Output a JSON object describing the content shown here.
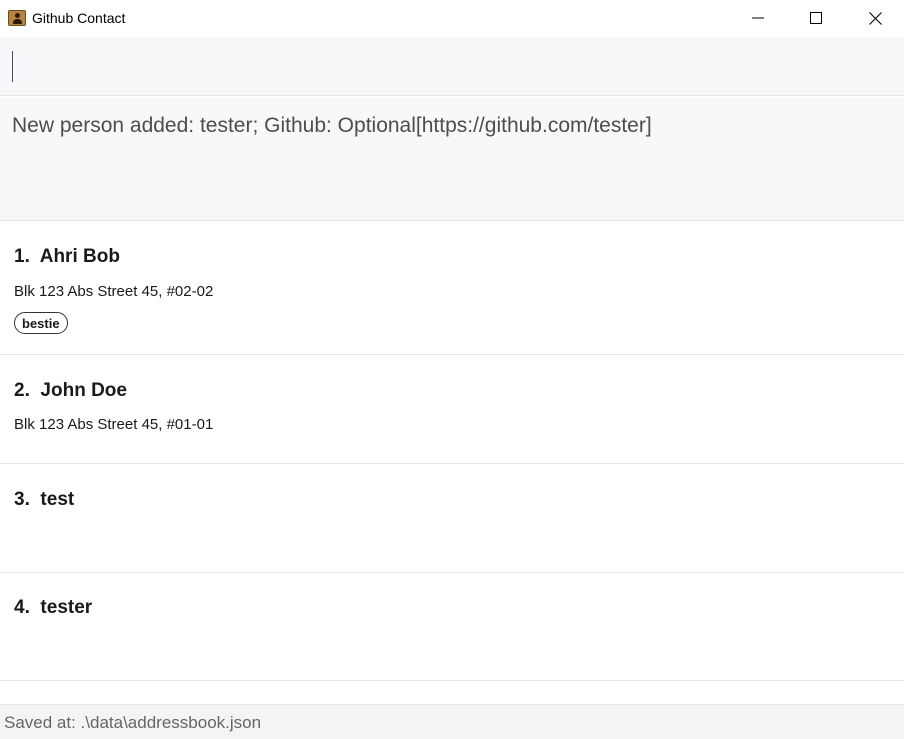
{
  "window": {
    "title": "Github Contact",
    "minimize_label": "Minimize",
    "maximize_label": "Maximize",
    "close_label": "Close"
  },
  "command": {
    "value": "",
    "placeholder": ""
  },
  "result": {
    "text": "New person added: tester; Github: Optional[https://github.com/tester]"
  },
  "persons": [
    {
      "index": "1.",
      "name": "Ahri Bob",
      "address": "Blk 123 Abs Street 45, #02-02",
      "tags": [
        "bestie"
      ]
    },
    {
      "index": "2.",
      "name": "John Doe",
      "address": "Blk 123 Abs Street 45, #01-01",
      "tags": []
    },
    {
      "index": "3.",
      "name": "test",
      "address": "",
      "tags": []
    },
    {
      "index": "4.",
      "name": "tester",
      "address": "",
      "tags": []
    }
  ],
  "status": {
    "text": "Saved at: .\\data\\addressbook.json"
  },
  "icons": {
    "app": "contact-book-icon",
    "minimize": "minimize-icon",
    "maximize": "maximize-icon",
    "close": "close-icon"
  },
  "colors": {
    "panel_background": "#f7f8fa",
    "divider": "#e3e5e8",
    "text_primary": "#1a1a1a",
    "text_secondary": "#4d4d4d"
  }
}
